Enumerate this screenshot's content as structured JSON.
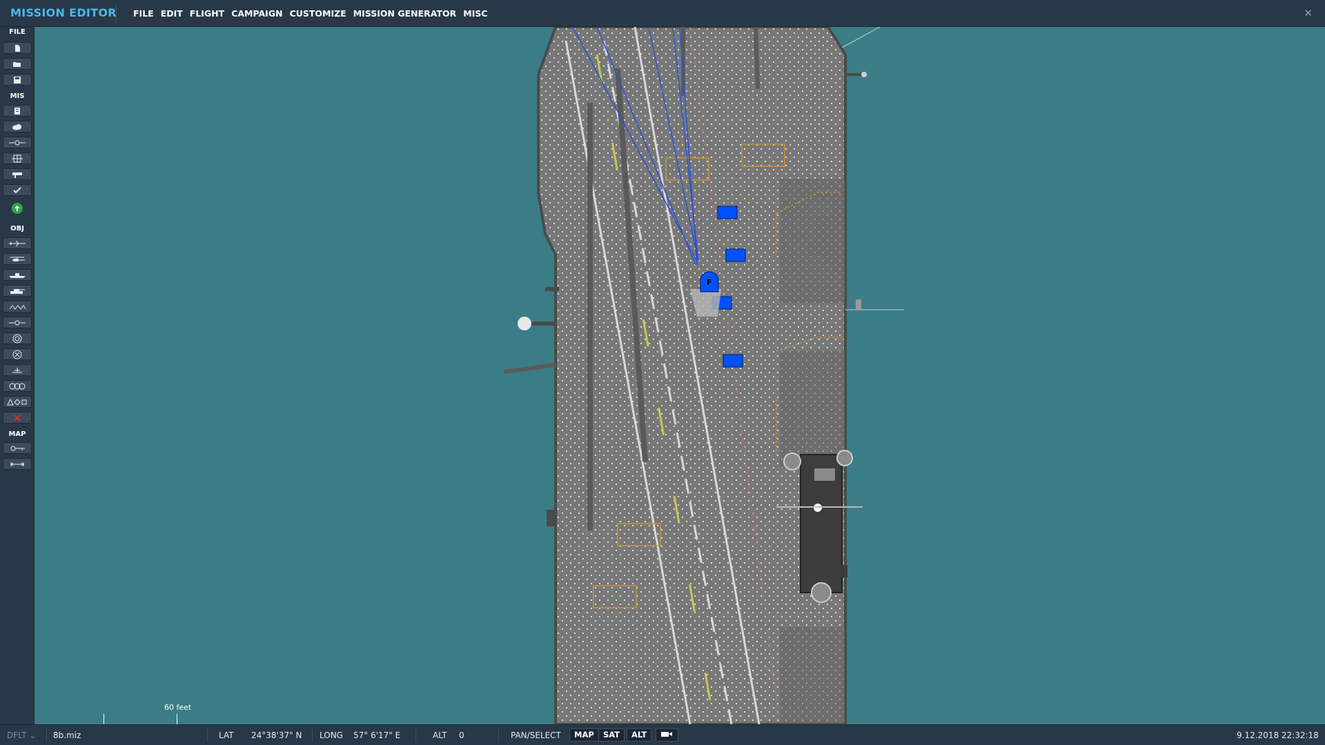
{
  "app": {
    "title": "MISSION EDITOR"
  },
  "menu": {
    "items": [
      "FILE",
      "EDIT",
      "FLIGHT",
      "CAMPAIGN",
      "CUSTOMIZE",
      "MISSION GENERATOR",
      "MISC"
    ]
  },
  "toolbar": {
    "sections": {
      "file": "FILE",
      "mis": "MIS",
      "obj": "OBJ",
      "map": "MAP"
    }
  },
  "map": {
    "group_label": "F",
    "scale_label": "60 feet"
  },
  "statusbar": {
    "profile": "DFLT",
    "filename": "8b.miz",
    "lat_label": "LAT",
    "lat_value": "24°38'37\" N",
    "long_label": "LONG",
    "long_value": "57° 6'17\" E",
    "alt_label": "ALT",
    "alt_value": "0",
    "mode": "PAN/SELECT",
    "btn_map": "MAP",
    "btn_sat": "SAT",
    "btn_alt": "ALT",
    "datetime": "9.12.2018 22:32:18"
  },
  "colors": {
    "sea": "#3a7d86",
    "panel": "#283848",
    "accent": "#4cb8e8",
    "unit_blue": "#0052ff"
  }
}
